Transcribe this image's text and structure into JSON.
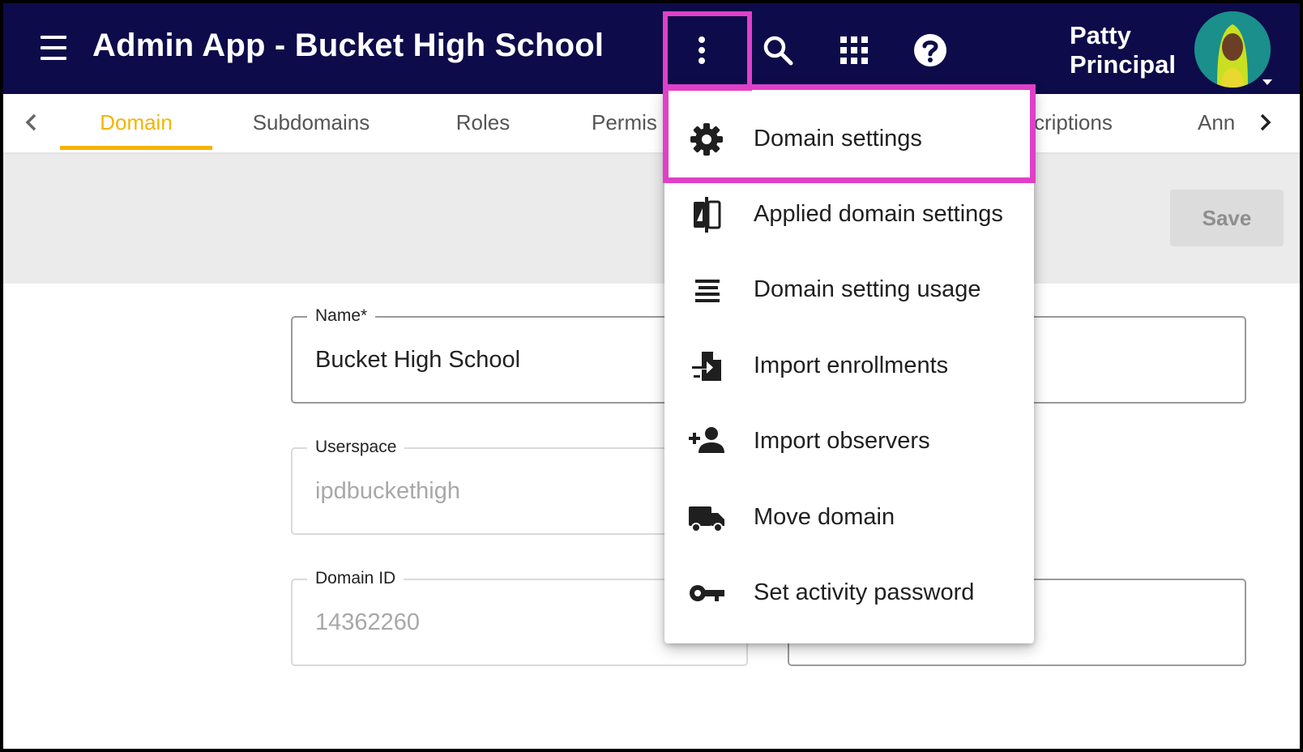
{
  "app_bar": {
    "title": "Admin App - Bucket High School",
    "user_first": "Patty",
    "user_last": "Principal",
    "background_color": "#0d0b4a"
  },
  "tabs": [
    {
      "label": "Domain",
      "active": true
    },
    {
      "label": "Subdomains",
      "active": false
    },
    {
      "label": "Roles",
      "active": false
    },
    {
      "label": "Permis",
      "active": false
    },
    {
      "label": "criptions",
      "active": false
    },
    {
      "label": "Ann",
      "active": false
    }
  ],
  "actions": {
    "save_label": "Save"
  },
  "form": {
    "name_label": "Name*",
    "name_value": "Bucket High School",
    "userspace_label": "Userspace",
    "userspace_value": "ipdbuckethigh",
    "domain_id_label": "Domain ID",
    "domain_id_value": "14362260"
  },
  "more_menu": {
    "items": [
      {
        "label": "Domain settings",
        "icon": "gear-icon"
      },
      {
        "label": "Applied domain settings",
        "icon": "compare-icon"
      },
      {
        "label": "Domain setting usage",
        "icon": "lines-icon"
      },
      {
        "label": "Import enrollments",
        "icon": "file-import-icon"
      },
      {
        "label": "Import observers",
        "icon": "person-add-icon"
      },
      {
        "label": "Move domain",
        "icon": "truck-icon"
      },
      {
        "label": "Set activity password",
        "icon": "key-icon"
      }
    ]
  },
  "colors": {
    "accent": "#f4b400",
    "highlight": "#e040c8",
    "app_bar": "#0d0b4a"
  }
}
